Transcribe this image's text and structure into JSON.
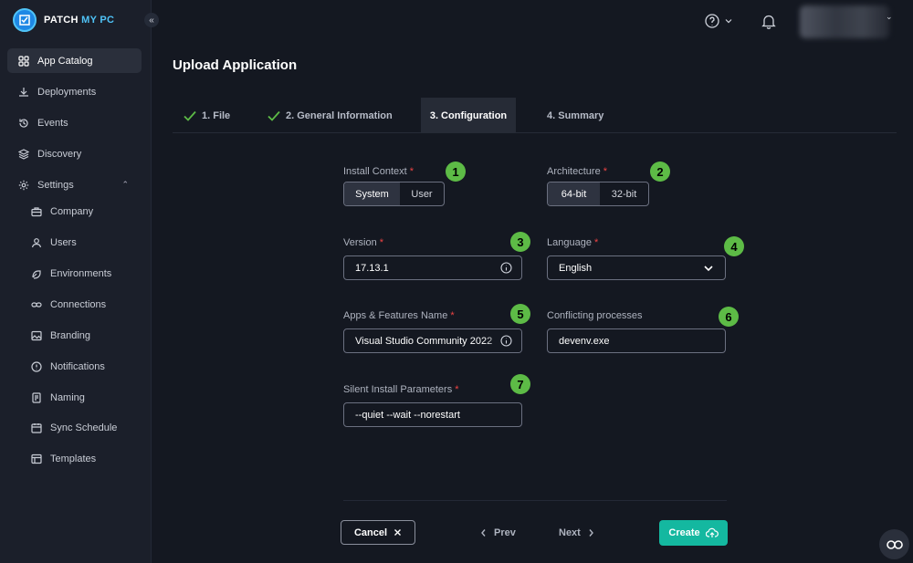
{
  "brand": {
    "name_part1": "PATCH",
    "name_part2": "MY PC"
  },
  "sidebar": {
    "items": [
      {
        "label": "App Catalog",
        "icon": "grid-icon"
      },
      {
        "label": "Deployments",
        "icon": "download-icon"
      },
      {
        "label": "Events",
        "icon": "history-icon"
      },
      {
        "label": "Discovery",
        "icon": "layers-icon"
      },
      {
        "label": "Settings",
        "icon": "gear-icon"
      }
    ],
    "settings_items": [
      {
        "label": "Company",
        "icon": "briefcase-icon"
      },
      {
        "label": "Users",
        "icon": "user-icon"
      },
      {
        "label": "Environments",
        "icon": "environment-icon"
      },
      {
        "label": "Connections",
        "icon": "link-icon"
      },
      {
        "label": "Branding",
        "icon": "image-icon"
      },
      {
        "label": "Notifications",
        "icon": "notification-icon"
      },
      {
        "label": "Naming",
        "icon": "document-icon"
      },
      {
        "label": "Sync Schedule",
        "icon": "calendar-icon"
      },
      {
        "label": "Templates",
        "icon": "template-icon"
      }
    ]
  },
  "page": {
    "title": "Upload Application"
  },
  "tabs": [
    {
      "label": "1. File",
      "done": true
    },
    {
      "label": "2. General Information",
      "done": true
    },
    {
      "label": "3. Configuration",
      "active": true
    },
    {
      "label": "4. Summary"
    }
  ],
  "form": {
    "install_context": {
      "label": "Install Context",
      "options": [
        "System",
        "User"
      ],
      "selected": "System",
      "badge": "1"
    },
    "architecture": {
      "label": "Architecture",
      "options": [
        "64-bit",
        "32-bit"
      ],
      "selected": "64-bit",
      "badge": "2"
    },
    "version": {
      "label": "Version",
      "value": "17.13.1",
      "badge": "3"
    },
    "language": {
      "label": "Language",
      "value": "English",
      "badge": "4"
    },
    "apps_features_name": {
      "label": "Apps & Features Name",
      "value": "Visual Studio Community 2022",
      "badge": "5"
    },
    "conflicting_processes": {
      "label": "Conflicting processes",
      "value": "devenv.exe",
      "badge": "6"
    },
    "silent_install": {
      "label": "Silent Install Parameters",
      "value": "--quiet --wait --norestart",
      "badge": "7"
    },
    "required_marker": "*"
  },
  "footer": {
    "cancel": "Cancel",
    "prev": "Prev",
    "next": "Next",
    "create": "Create"
  },
  "colors": {
    "accent": "#14b8a0",
    "badge": "#5dbb46",
    "required": "#ef4444",
    "background": "#141821"
  }
}
